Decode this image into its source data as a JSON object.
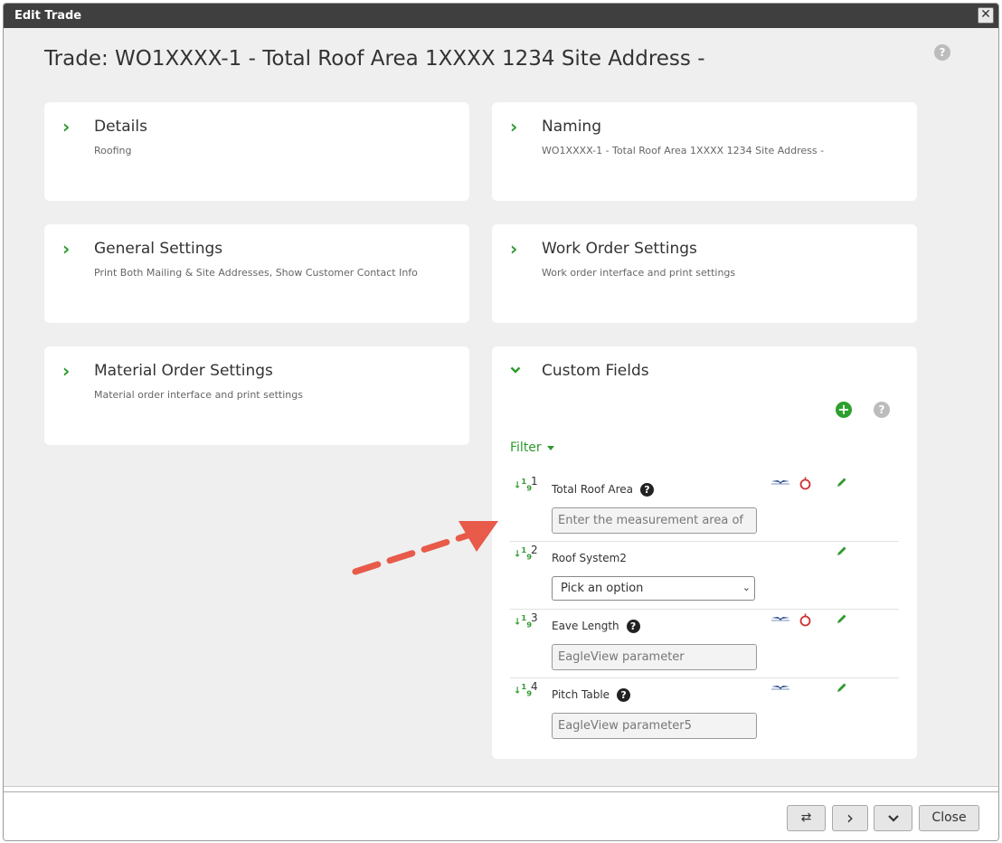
{
  "dialog": {
    "title": "Edit Trade",
    "close_icon": "close-icon"
  },
  "page": {
    "title": "Trade: WO1XXXX-1 - Total Roof Area 1XXXX 1234 Site Address -",
    "help_icon": "?"
  },
  "cards": {
    "details": {
      "title": "Details",
      "subtitle": "Roofing"
    },
    "naming": {
      "title": "Naming",
      "subtitle": "WO1XXXX-1 - Total Roof Area 1XXXX 1234 Site Address -"
    },
    "general": {
      "title": "General Settings",
      "subtitle": "Print Both Mailing & Site Addresses, Show Customer Contact Info"
    },
    "work_order": {
      "title": "Work Order Settings",
      "subtitle": "Work order interface and print settings"
    },
    "material_order": {
      "title": "Material Order Settings",
      "subtitle": "Material order interface and print settings"
    }
  },
  "custom_fields": {
    "title": "Custom Fields",
    "add_icon": "+",
    "help_icon": "?",
    "filter_label": "Filter",
    "rows": [
      {
        "num": "1",
        "label": "Total Roof Area",
        "has_help": true,
        "placeholder": "Enter the measurement area of",
        "type": "input",
        "icons": [
          "eagleview-icon",
          "hover-icon"
        ]
      },
      {
        "num": "2",
        "label": "Roof System2",
        "has_help": false,
        "value": "Pick an option",
        "type": "select",
        "icons": []
      },
      {
        "num": "3",
        "label": "Eave Length",
        "has_help": true,
        "placeholder": "EagleView parameter",
        "type": "input",
        "icons": [
          "eagleview-icon",
          "hover-icon"
        ]
      },
      {
        "num": "4",
        "label": "Pitch Table",
        "has_help": true,
        "placeholder": "EagleView parameter5",
        "type": "input",
        "icons": [
          "eagleview-icon"
        ]
      }
    ]
  },
  "footer": {
    "swap_icon": "⇄",
    "next_icon": "›",
    "down_icon": "⌄",
    "close_label": "Close"
  },
  "colors": {
    "accent": "#2e9a2e",
    "titlebar": "#3f3f3f",
    "annotation_arrow": "#e85a4a"
  }
}
